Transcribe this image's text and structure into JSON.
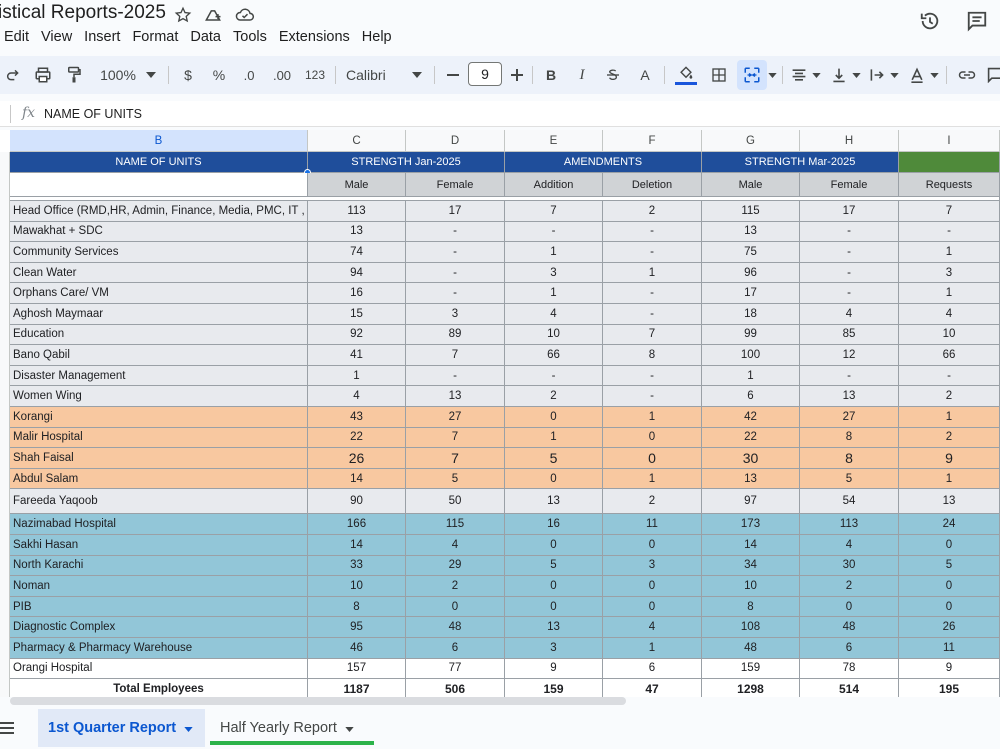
{
  "doc": {
    "title": "istical Reports-2025"
  },
  "menu": [
    "Edit",
    "View",
    "Insert",
    "Format",
    "Data",
    "Tools",
    "Extensions",
    "Help"
  ],
  "toolbar": {
    "zoom": "100%",
    "currency": "$",
    "percent": "%",
    "dec_less": ".0",
    "dec_more": ".00",
    "number_format": "123",
    "font": "Calibri",
    "font_size": "9",
    "bold": "B",
    "italic": "I",
    "text_color": "A"
  },
  "formula_bar": {
    "fx": "fx",
    "content": "NAME OF UNITS"
  },
  "columns": [
    "B",
    "C",
    "D",
    "E",
    "F",
    "G",
    "H",
    "I"
  ],
  "header": {
    "name_of_units": "NAME OF UNITS",
    "strength_jan": "STRENGTH Jan-2025",
    "amendments": "AMENDMENTS",
    "strength_mar": "STRENGTH Mar-2025",
    "sub": [
      "Male",
      "Female",
      "Addition",
      "Deletion",
      "Male",
      "Female",
      "Requests"
    ]
  },
  "rows": [
    {
      "name": "Head Office (RMD,HR, Admin, Finance, Media, PMC, IT , MSP, C",
      "v": [
        "113",
        "17",
        "7",
        "2",
        "115",
        "17",
        "7"
      ],
      "band": "gray"
    },
    {
      "name": "Mawakhat + SDC",
      "v": [
        "13",
        "-",
        "-",
        "-",
        "13",
        "-",
        "-"
      ],
      "band": "gray"
    },
    {
      "name": "Community Services",
      "v": [
        "74",
        "-",
        "1",
        "-",
        "75",
        "-",
        "1"
      ],
      "band": "gray"
    },
    {
      "name": "Clean Water",
      "v": [
        "94",
        "-",
        "3",
        "1",
        "96",
        "-",
        "3"
      ],
      "band": "gray"
    },
    {
      "name": "Orphans Care/ VM",
      "v": [
        "16",
        "-",
        "1",
        "-",
        "17",
        "-",
        "1"
      ],
      "band": "gray"
    },
    {
      "name": "Aghosh Maymaar",
      "v": [
        "15",
        "3",
        "4",
        "-",
        "18",
        "4",
        "4"
      ],
      "band": "gray"
    },
    {
      "name": "Education",
      "v": [
        "92",
        "89",
        "10",
        "7",
        "99",
        "85",
        "10"
      ],
      "band": "gray"
    },
    {
      "name": "Bano Qabil",
      "v": [
        "41",
        "7",
        "66",
        "8",
        "100",
        "12",
        "66"
      ],
      "band": "gray"
    },
    {
      "name": "Disaster Management",
      "v": [
        "1",
        "-",
        "-",
        "-",
        "1",
        "-",
        "-"
      ],
      "band": "gray"
    },
    {
      "name": "Women Wing",
      "v": [
        "4",
        "13",
        "2",
        "-",
        "6",
        "13",
        "2"
      ],
      "band": "gray"
    },
    {
      "name": "Korangi",
      "v": [
        "43",
        "27",
        "0",
        "1",
        "42",
        "27",
        "1"
      ],
      "band": "orange"
    },
    {
      "name": "Malir Hospital",
      "v": [
        "22",
        "7",
        "1",
        "0",
        "22",
        "8",
        "2"
      ],
      "band": "orange"
    },
    {
      "name": "Shah Faisal",
      "v": [
        "26",
        "7",
        "5",
        "0",
        "30",
        "8",
        "9"
      ],
      "band": "orange",
      "big": true
    },
    {
      "name": "Abdul Salam",
      "v": [
        "14",
        "5",
        "0",
        "1",
        "13",
        "5",
        "1"
      ],
      "band": "orange"
    },
    {
      "name": "Fareeda Yaqoob",
      "v": [
        "90",
        "50",
        "13",
        "2",
        "97",
        "54",
        "13"
      ],
      "band": "gray",
      "tall": true
    },
    {
      "name": "Nazimabad Hospital",
      "v": [
        "166",
        "115",
        "16",
        "11",
        "173",
        "113",
        "24"
      ],
      "band": "blue"
    },
    {
      "name": "Sakhi Hasan",
      "v": [
        "14",
        "4",
        "0",
        "0",
        "14",
        "4",
        "0"
      ],
      "band": "blue"
    },
    {
      "name": "North Karachi",
      "v": [
        "33",
        "29",
        "5",
        "3",
        "34",
        "30",
        "5"
      ],
      "band": "blue"
    },
    {
      "name": "Noman",
      "v": [
        "10",
        "2",
        "0",
        "0",
        "10",
        "2",
        "0"
      ],
      "band": "blue"
    },
    {
      "name": "PIB",
      "v": [
        "8",
        "0",
        "0",
        "0",
        "8",
        "0",
        "0"
      ],
      "band": "blue"
    },
    {
      "name": "Diagnostic Complex",
      "v": [
        "95",
        "48",
        "13",
        "4",
        "108",
        "48",
        "26"
      ],
      "band": "blue"
    },
    {
      "name": "Pharmacy & Pharmacy Warehouse",
      "v": [
        "46",
        "6",
        "3",
        "1",
        "48",
        "6",
        "11"
      ],
      "band": "blue"
    },
    {
      "name": "Orangi Hospital",
      "v": [
        "157",
        "77",
        "9",
        "6",
        "159",
        "78",
        "9"
      ],
      "band": "white"
    }
  ],
  "total": {
    "label": "Total Employees",
    "v": [
      "1187",
      "506",
      "159",
      "47",
      "1298",
      "514",
      "195"
    ]
  },
  "sheets": [
    {
      "label": "1st Quarter Report",
      "active": true
    },
    {
      "label": "Half Yearly Report",
      "active": false
    }
  ],
  "colors": {
    "gray": "#e8eaee",
    "orange": "#f8c8a0",
    "blue": "#92c6d8",
    "white": "#ffffff",
    "header_blue": "#1f4e9b",
    "header_green": "#4f8a3a"
  }
}
